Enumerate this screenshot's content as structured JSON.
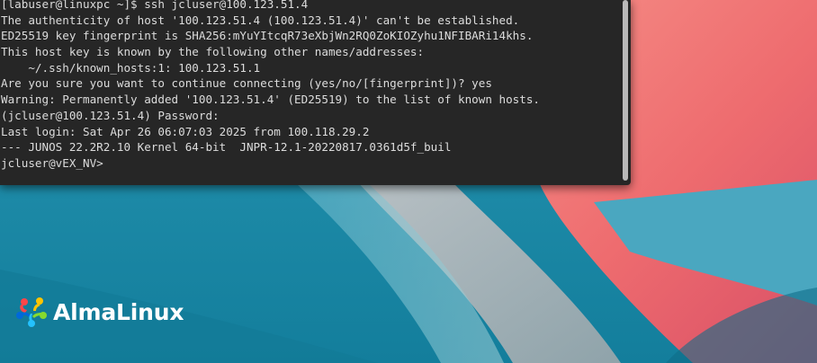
{
  "terminal": {
    "lines": [
      "[labuser@linuxpc ~]$ ssh jcluser@100.123.51.4",
      "The authenticity of host '100.123.51.4 (100.123.51.4)' can't be established.",
      "ED25519 key fingerprint is SHA256:mYuYItcqR73eXbjWn2RQ0ZoKIOZyhu1NFIBARi14khs.",
      "This host key is known by the following other names/addresses:",
      "    ~/.ssh/known_hosts:1: 100.123.51.1",
      "Are you sure you want to continue connecting (yes/no/[fingerprint])? yes",
      "Warning: Permanently added '100.123.51.4' (ED25519) to the list of known hosts.",
      "(jcluser@100.123.51.4) Password:",
      "Last login: Sat Apr 26 06:07:03 2025 from 100.118.29.2",
      "--- JUNOS 22.2R2.10 Kernel 64-bit  JNPR-12.1-20220817.0361d5f_buil",
      "jcluser@vEX_NV>"
    ]
  },
  "desktop": {
    "logo_text": "AlmaLinux"
  },
  "colors": {
    "terminal_bg": "#262626",
    "terminal_fg": "#dcdcdc",
    "wallpaper_teal": "#1d8aa6",
    "wallpaper_coral": "#ef6f6a",
    "logo_text": "#ffffff"
  }
}
